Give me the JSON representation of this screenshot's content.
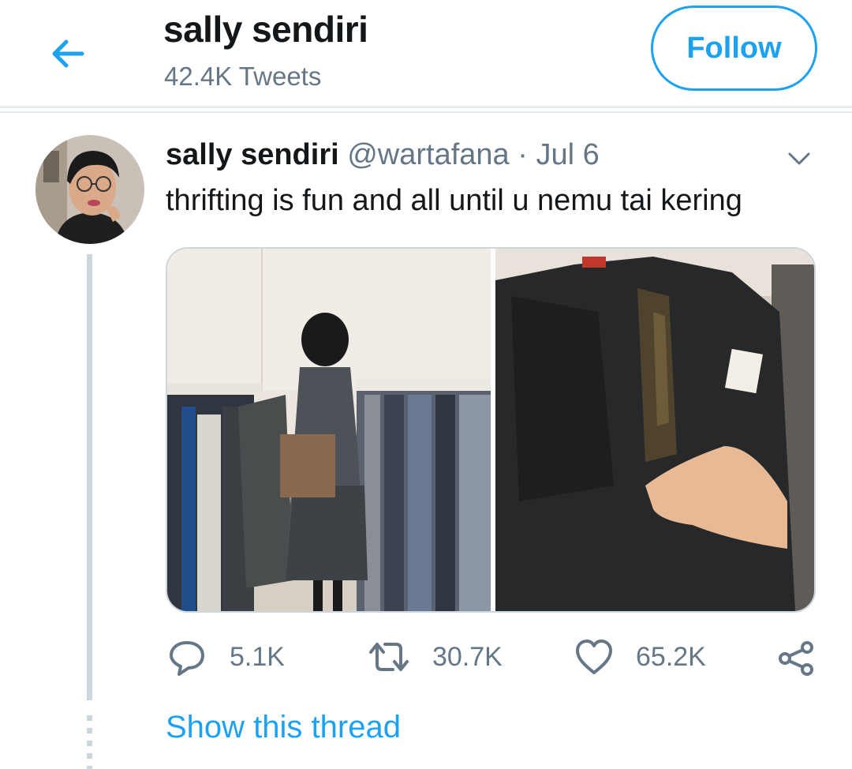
{
  "header": {
    "back_icon": "arrow-left-icon",
    "title": "sally sendiri",
    "tweet_count": "42.4K Tweets",
    "follow_label": "Follow"
  },
  "tweet": {
    "display_name": "sally sendiri",
    "handle": "@wartafana",
    "separator": "·",
    "date": "Jul 6",
    "text": "thrifting is fun and all until u nemu tai kering",
    "media": [
      "photo-thrift-store-rack",
      "photo-black-jeans-closeup"
    ],
    "actions": {
      "replies": "5.1K",
      "retweets": "30.7K",
      "likes": "65.2K"
    },
    "show_thread": "Show this thread"
  },
  "colors": {
    "accent": "#1da1f2",
    "secondary_text": "#657786",
    "divider": "#e6ecf0"
  }
}
